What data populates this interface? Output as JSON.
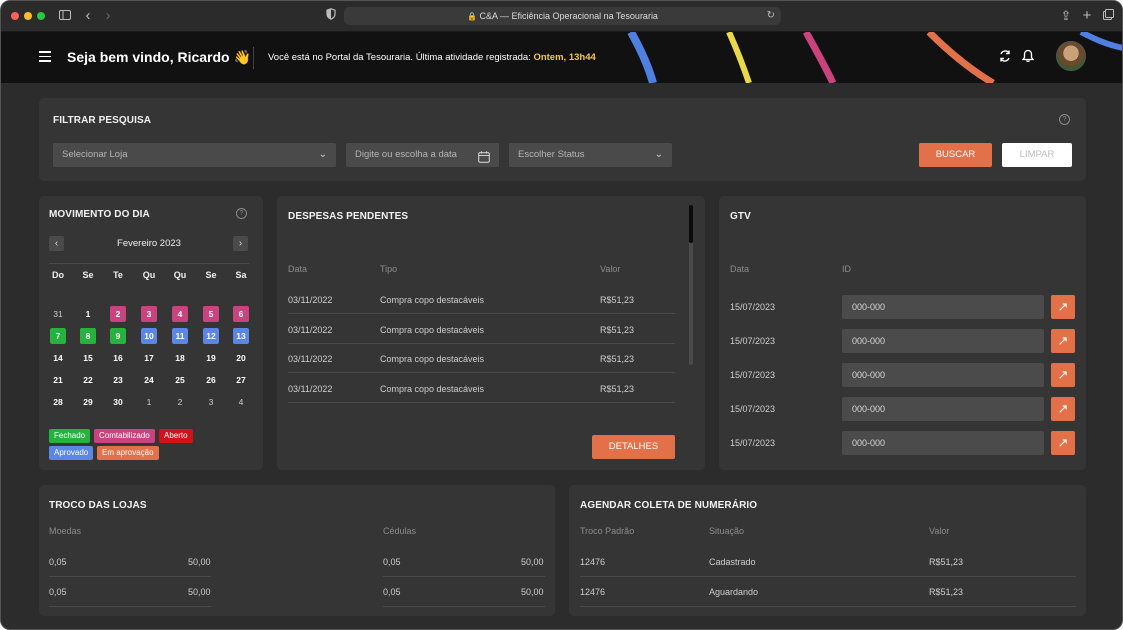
{
  "browser": {
    "url_text": "C&A — Eficiência Operacional na Tesouraria"
  },
  "header": {
    "welcome": "Seja bem vindo, Ricardo",
    "wave_emoji": "👋",
    "portal_text": "Você está no Portal da Tesouraria. Última atividade registrada: ",
    "last_activity": "Ontem, 13h44"
  },
  "filter": {
    "title": "FILTRAR PESQUISA",
    "store_placeholder": "Selecionar Loja",
    "date_placeholder": "Digite ou escolha a data",
    "status_placeholder": "Escolher Status",
    "search_label": "BUSCAR",
    "clear_label": "LIMPAR"
  },
  "movement": {
    "title": "MOVIMENTO DO DIA",
    "month": "Fevereiro 2023",
    "weekdays": [
      "Do",
      "Se",
      "Te",
      "Qu",
      "Qu",
      "Se",
      "Sa"
    ],
    "weeks": [
      [
        {
          "d": "31",
          "s": "dim"
        },
        {
          "d": "1",
          "s": ""
        },
        {
          "d": "2",
          "s": "contab"
        },
        {
          "d": "3",
          "s": "contab"
        },
        {
          "d": "4",
          "s": "contab"
        },
        {
          "d": "5",
          "s": "contab"
        },
        {
          "d": "6",
          "s": "contab"
        }
      ],
      [
        {
          "d": "7",
          "s": "fechado"
        },
        {
          "d": "8",
          "s": "fechado"
        },
        {
          "d": "9",
          "s": "fechado"
        },
        {
          "d": "10",
          "s": "aprovado"
        },
        {
          "d": "11",
          "s": "aprovado"
        },
        {
          "d": "12",
          "s": "aprovado"
        },
        {
          "d": "13",
          "s": "aprovado"
        }
      ],
      [
        {
          "d": "14",
          "s": ""
        },
        {
          "d": "15",
          "s": ""
        },
        {
          "d": "16",
          "s": ""
        },
        {
          "d": "17",
          "s": ""
        },
        {
          "d": "18",
          "s": ""
        },
        {
          "d": "19",
          "s": ""
        },
        {
          "d": "20",
          "s": ""
        }
      ],
      [
        {
          "d": "21",
          "s": ""
        },
        {
          "d": "22",
          "s": ""
        },
        {
          "d": "23",
          "s": ""
        },
        {
          "d": "24",
          "s": ""
        },
        {
          "d": "25",
          "s": ""
        },
        {
          "d": "26",
          "s": ""
        },
        {
          "d": "27",
          "s": ""
        }
      ],
      [
        {
          "d": "28",
          "s": ""
        },
        {
          "d": "29",
          "s": ""
        },
        {
          "d": "30",
          "s": ""
        },
        {
          "d": "1",
          "s": "dim"
        },
        {
          "d": "2",
          "s": "dim"
        },
        {
          "d": "3",
          "s": "dim"
        },
        {
          "d": "4",
          "s": "dim"
        }
      ]
    ],
    "legend": {
      "fechado": "Fechado",
      "contabilizado": "Comtabilizado",
      "aberto": "Aberto",
      "aprovado": "Aprovado",
      "em_aprovacao": "Em aprovação"
    },
    "colors": {
      "fechado": "#27b23d",
      "contab": "#c9447e",
      "aberto": "#d0131b",
      "aprovado": "#5b86e5",
      "em_aprovacao": "#e2714a"
    }
  },
  "expenses": {
    "title": "DESPESAS PENDENTES",
    "headers": [
      "Data",
      "Tipo",
      "Valor"
    ],
    "rows": [
      [
        "03/11/2022",
        "Compra copo destacáveis",
        "R$51,23"
      ],
      [
        "03/11/2022",
        "Compra copo destacáveis",
        "R$51,23"
      ],
      [
        "03/11/2022",
        "Compra copo destacáveis",
        "R$51,23"
      ],
      [
        "03/11/2022",
        "Compra copo destacáveis",
        "R$51,23"
      ]
    ],
    "details_label": "DETALHES"
  },
  "gtv": {
    "title": "GTV",
    "headers": [
      "Data",
      "ID"
    ],
    "rows": [
      [
        "15/07/2023",
        "000-000"
      ],
      [
        "15/07/2023",
        "000-000"
      ],
      [
        "15/07/2023",
        "000-000"
      ],
      [
        "15/07/2023",
        "000-000"
      ],
      [
        "15/07/2023",
        "000-000"
      ]
    ]
  },
  "change": {
    "title": "TROCO DAS LOJAS",
    "coins_header": "Moedas",
    "notes_header": "Cédulas",
    "rows": [
      [
        "0,05",
        "50,00",
        "0,05",
        "50,00"
      ],
      [
        "0,05",
        "50,00",
        "0,05",
        "50,00"
      ]
    ]
  },
  "pickup": {
    "title": "AGENDAR COLETA DE NUMERÁRIO",
    "headers": [
      "Troco Padrão",
      "Situação",
      "Valor"
    ],
    "rows": [
      [
        "12476",
        "Cadastrado",
        "R$51,23"
      ],
      [
        "12476",
        "Aguardando",
        "R$51,23"
      ]
    ]
  }
}
